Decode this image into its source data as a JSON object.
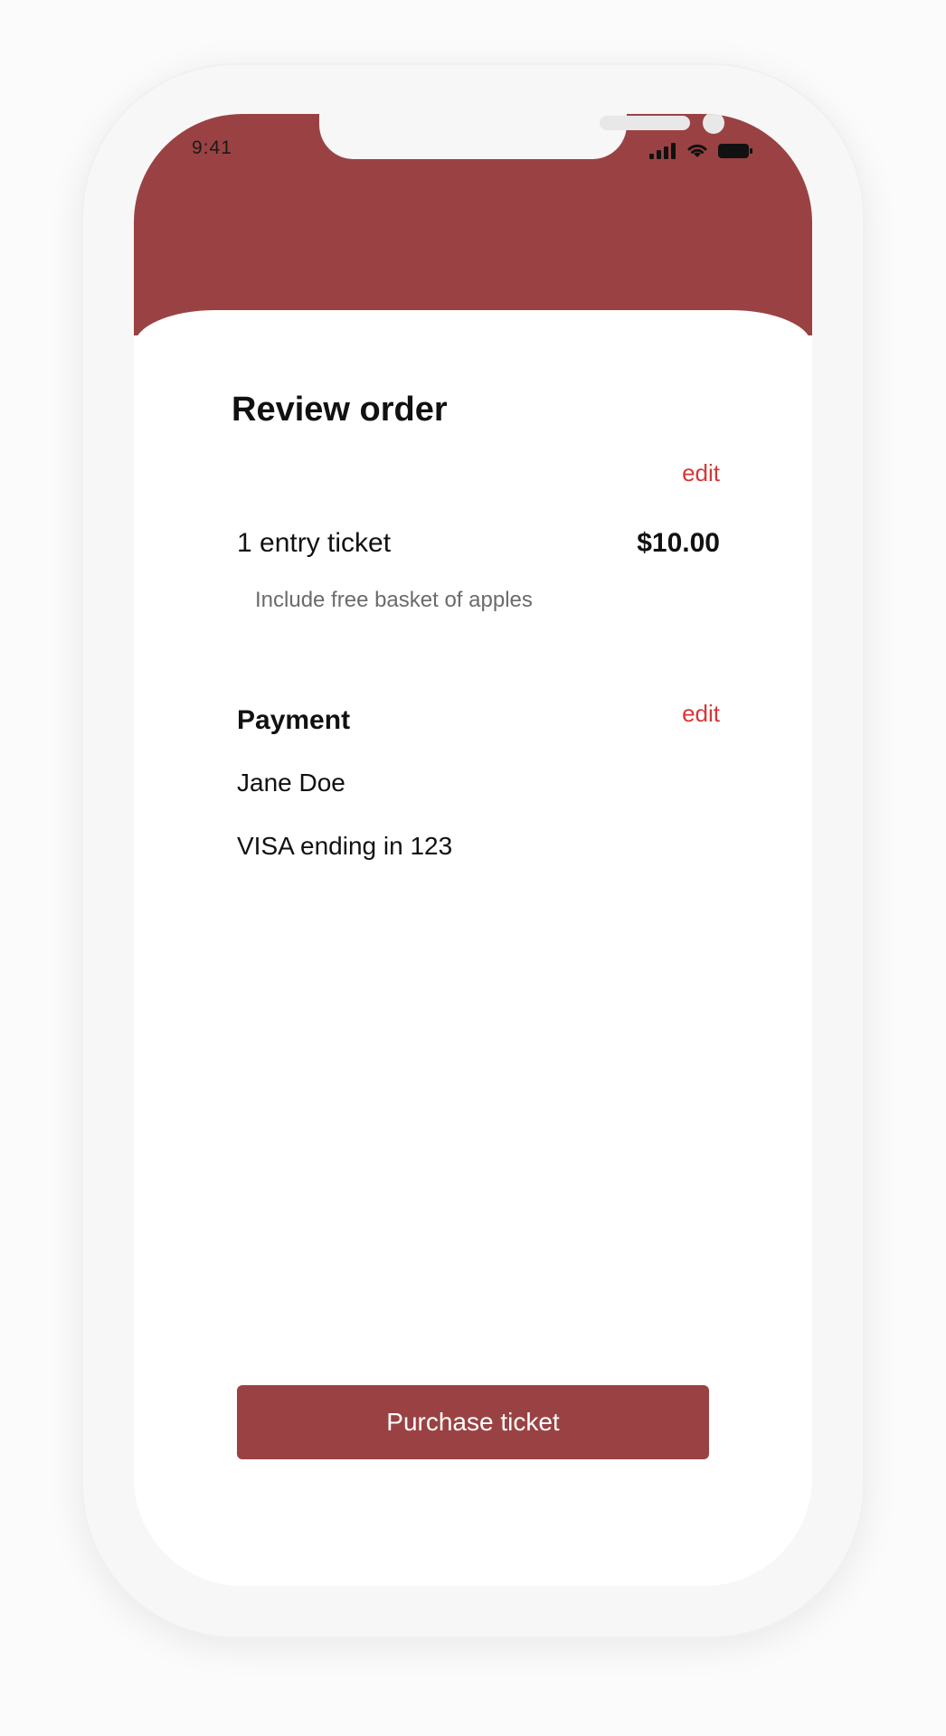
{
  "status_bar": {
    "time": "9:41",
    "icons": [
      "signal-icon",
      "wifi-icon",
      "battery-icon"
    ]
  },
  "order": {
    "title": "Review order",
    "edit_label": "edit",
    "item_label": "1 entry ticket",
    "item_price": "$10.00",
    "item_note": "Include free basket of apples"
  },
  "payment": {
    "heading": "Payment",
    "edit_label": "edit",
    "name": "Jane Doe",
    "card": "VISA ending in 123"
  },
  "actions": {
    "purchase_label": "Purchase ticket"
  },
  "colors": {
    "accent": "#9a4243",
    "edit_link": "#d93636"
  }
}
